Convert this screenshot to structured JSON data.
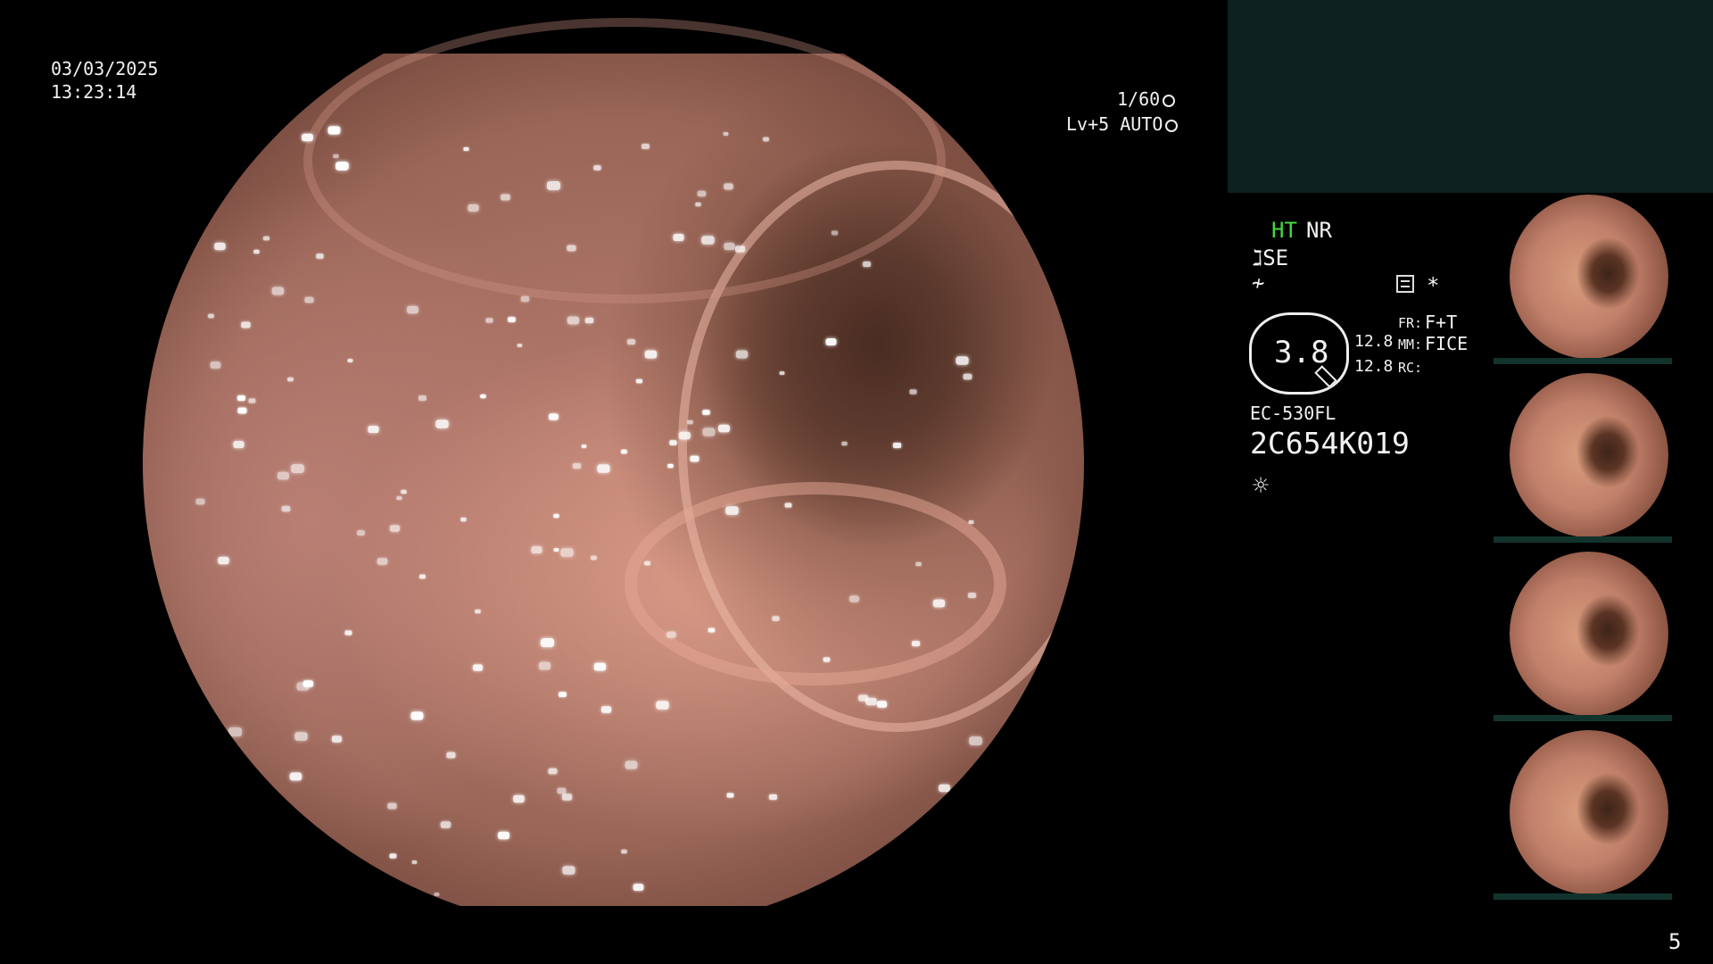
{
  "timestamp": {
    "date": "03/03/2025",
    "time": "13:23:14"
  },
  "camera": {
    "shutter": "1/60",
    "level": "Lv+5",
    "mode": "AUTO"
  },
  "status": {
    "ht": "HT",
    "nr": "NR",
    "se": "SE",
    "f_symbol": "≁",
    "asterisk": "*",
    "zoom_value": "3.8",
    "value_1": "12.8",
    "value_2": "12.8",
    "fr_label": "FR:",
    "fr_value": "F+T",
    "mm_label": "MM:",
    "mm_value": "FICE",
    "rc_label": "RC:",
    "scope_model": "EC-530FL",
    "serial": "2C654K019",
    "light_icon": "☼"
  },
  "thumbnails": [
    {
      "kind": "thumb-1"
    },
    {
      "kind": "thumb-2"
    },
    {
      "kind": "thumb-3"
    },
    {
      "kind": "thumb-4"
    }
  ],
  "colors": {
    "accent_green": "#3fdc3f",
    "panel_green": "#0d211e",
    "thumb_bar": "#12332c"
  },
  "page_number": "5"
}
